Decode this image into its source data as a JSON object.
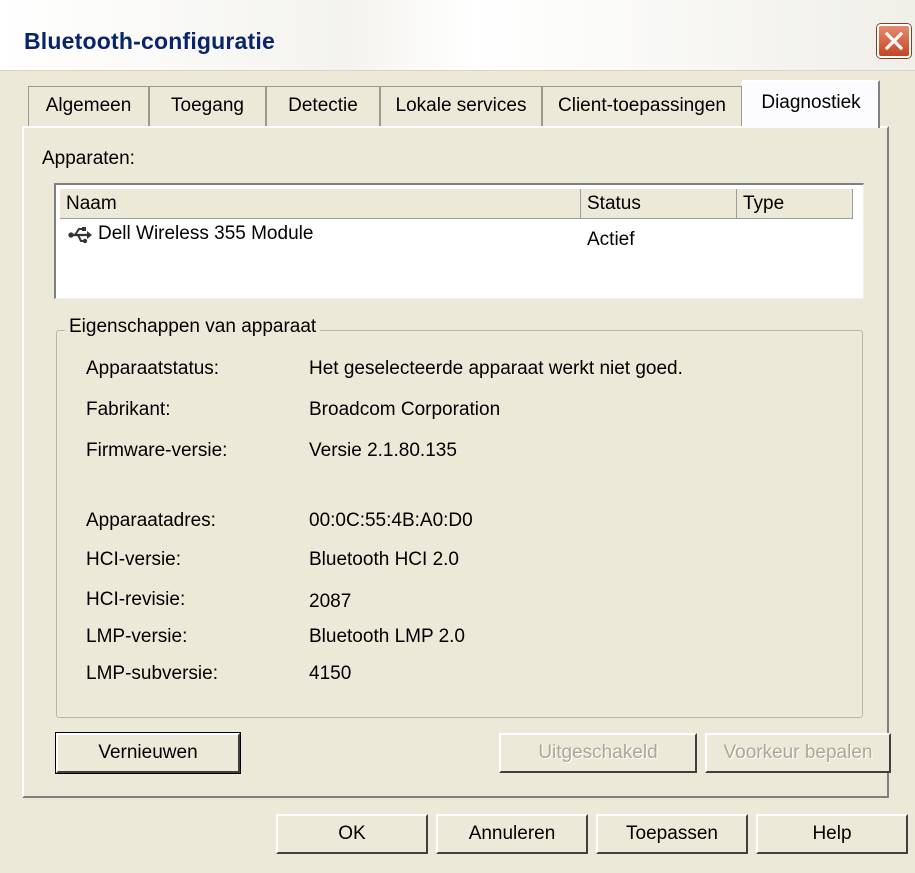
{
  "window": {
    "title": "Bluetooth-configuratie"
  },
  "tabs": [
    {
      "label": "Algemeen"
    },
    {
      "label": "Toegang"
    },
    {
      "label": "Detectie"
    },
    {
      "label": "Lokale services"
    },
    {
      "label": "Client-toepassingen"
    },
    {
      "label": "Diagnostiek",
      "active": true
    }
  ],
  "devices": {
    "label": "Apparaten:",
    "columns": [
      "Naam",
      "Status",
      "Type"
    ],
    "rows": [
      {
        "name": "Dell Wireless 355 Module",
        "status": "Actief",
        "type": "",
        "icon": "usb-icon"
      }
    ]
  },
  "properties": {
    "legend": "Eigenschappen van apparaat",
    "items": [
      {
        "label": "Apparaatstatus:",
        "value": "Het geselecteerde apparaat werkt niet goed."
      },
      {
        "label": "Fabrikant:",
        "value": "Broadcom Corporation"
      },
      {
        "label": "Firmware-versie:",
        "value": "Versie 2.1.80.135"
      },
      {
        "label": "Apparaatadres:",
        "value": "00:0C:55:4B:A0:D0"
      },
      {
        "label": "HCI-versie:",
        "value": "Bluetooth HCI 2.0"
      },
      {
        "label": "HCI-revisie:",
        "value": "2087"
      },
      {
        "label": "LMP-versie:",
        "value": "Bluetooth LMP 2.0"
      },
      {
        "label": "LMP-subversie:",
        "value": "4150"
      }
    ]
  },
  "panel_buttons": {
    "refresh": "Vernieuwen",
    "disable": "Uitgeschakeld",
    "set_preferred": "Voorkeur bepalen"
  },
  "dialog_buttons": {
    "ok": "OK",
    "cancel": "Annuleren",
    "apply": "Toepassen",
    "help": "Help"
  },
  "colors": {
    "title_text": "#0a246a",
    "close_button": "#c64522",
    "dialog_bg": "#ece9d8",
    "disabled_text": "#aca899"
  }
}
